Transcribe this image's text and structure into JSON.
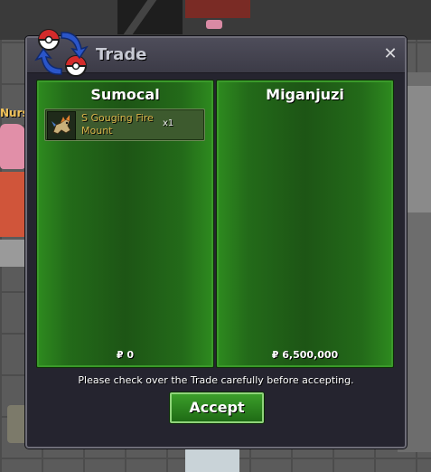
{
  "background": {
    "npc_label": "Nurse"
  },
  "window": {
    "title": "Trade",
    "close_label": "✕",
    "icon": "trade-icon"
  },
  "left_panel": {
    "player": "Sumocal",
    "items": [
      {
        "name": "S Gouging Fire Mount",
        "quantity": "x1",
        "icon": "mount-icon"
      }
    ],
    "money": "₽ 0"
  },
  "right_panel": {
    "player": "Miganjuzi",
    "items": [],
    "money": "₽ 6,500,000"
  },
  "notice": "Please check over the Trade carefully before accepting.",
  "accept_label": "Accept",
  "colors": {
    "panel_green": "#236a19",
    "accept_green": "#2f8c22",
    "item_text": "#d9b44a",
    "window_bg": "#25242f"
  }
}
